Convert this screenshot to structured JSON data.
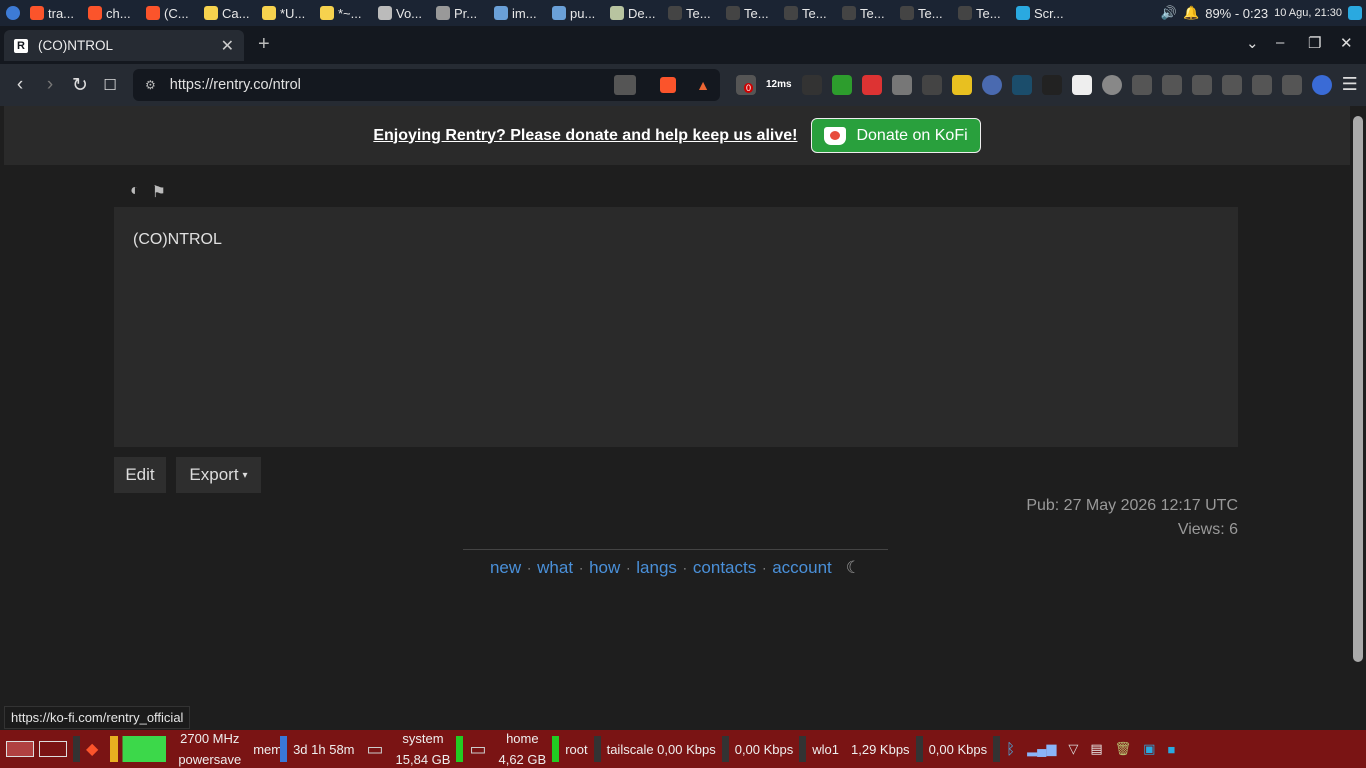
{
  "top_taskbar": {
    "items": [
      {
        "label": "tra...",
        "color": "#fb542b"
      },
      {
        "label": "ch...",
        "color": "#fb542b"
      },
      {
        "label": "(C...",
        "color": "#fb542b"
      },
      {
        "label": "Ca...",
        "color": "#f6d24e"
      },
      {
        "label": "*U...",
        "color": "#f6d24e"
      },
      {
        "label": "*~...",
        "color": "#f6d24e"
      },
      {
        "label": "Vo...",
        "color": "#bbbbbb"
      },
      {
        "label": "Pr...",
        "color": "#999999"
      },
      {
        "label": "im...",
        "color": "#6aa0d8"
      },
      {
        "label": "pu...",
        "color": "#6aa0d8"
      },
      {
        "label": "De...",
        "color": "#b8c4a0"
      },
      {
        "label": "Te...",
        "color": "#444444"
      },
      {
        "label": "Te...",
        "color": "#444444"
      },
      {
        "label": "Te...",
        "color": "#444444"
      },
      {
        "label": "Te...",
        "color": "#444444"
      },
      {
        "label": "Te...",
        "color": "#444444"
      },
      {
        "label": "Te...",
        "color": "#444444"
      },
      {
        "label": "Scr...",
        "color": "#2aa9e0"
      }
    ],
    "battery": "89% - 0:23",
    "date_time": "10 Agu, 21:30"
  },
  "browser": {
    "tab_title": "(CO)NTROL",
    "url": "https://rentry.co/ntrol",
    "ext_badges": {
      "count": "0",
      "ping": "12ms"
    }
  },
  "page": {
    "banner_text": "Enjoying Rentry? Please donate and help keep us alive!",
    "donate_label": "Donate on KoFi",
    "entry_text": "(CO)NTROL",
    "edit_label": "Edit",
    "export_label": "Export",
    "pub": "Pub: 27 May 2026 12:17 UTC",
    "views": "Views: 6",
    "footer_links": [
      "new",
      "what",
      "how",
      "langs",
      "contacts",
      "account"
    ],
    "status_url": "https://ko-fi.com/rentry_official"
  },
  "bottom_panel": {
    "cpu_freq": "2700 MHz",
    "cpu_mode": "powersave",
    "mem_label": "mem",
    "uptime": "3d 1h 58m",
    "system_label": "system",
    "system_size": "15,84 GB",
    "home_label": "home",
    "home_size": "4,62 GB",
    "root_label": "root",
    "tailscale": "tailscale 0,00 Kbps",
    "tailscale2": "0,00 Kbps",
    "wlo1": "wlo1",
    "wlo1_down": "1,29 Kbps",
    "wlo1_up": "0,00 Kbps"
  }
}
